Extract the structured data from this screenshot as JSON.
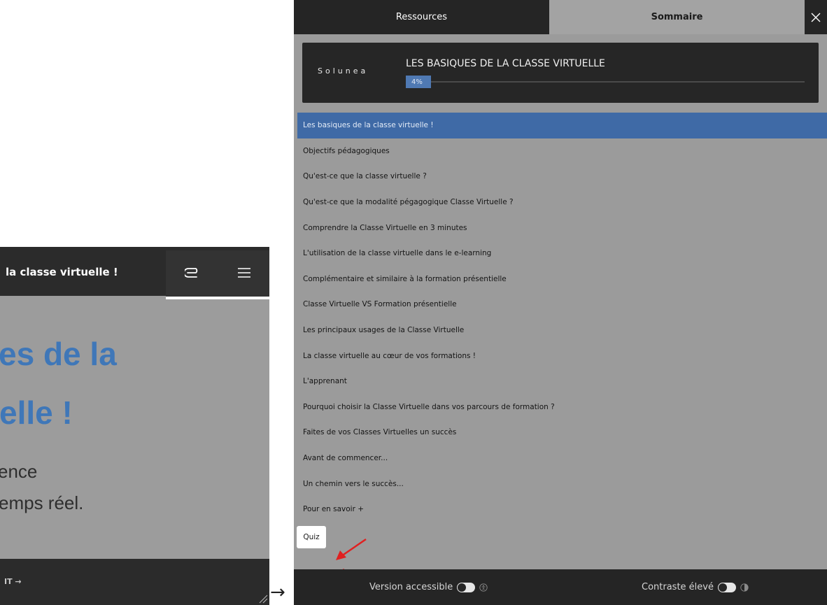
{
  "preview": {
    "header_title": "la classe virtuelle !",
    "hero_line1": "es de la",
    "hero_line2": "elle !",
    "hero_sub1": "ence",
    "hero_sub2": "emps réel.",
    "footer_cta": "IT →",
    "icons": {
      "clip": "paperclip-icon",
      "menu": "hamburger-menu-icon"
    }
  },
  "transition_arrow": "→",
  "panel": {
    "tabs": [
      {
        "label": "Ressources",
        "active": false
      },
      {
        "label": "Sommaire",
        "active": true
      }
    ],
    "close_icon": "close-icon",
    "course": {
      "logo": "Solunea",
      "title": "LES BASIQUES DE LA CLASSE VIRTUELLE",
      "progress_label": "4%",
      "progress": 0.04
    },
    "chapters": [
      {
        "label": "Les basiques de la classe virtuelle !",
        "active": true
      },
      {
        "label": "Objectifs pédagogiques"
      },
      {
        "label": "Qu'est-ce que la classe virtuelle ?"
      },
      {
        "label": "Qu'est-ce que la modalité pégagogique Classe Virtuelle ?"
      },
      {
        "label": "Comprendre la Classe Virtuelle en 3 minutes"
      },
      {
        "label": "L'utilisation de la classe virtuelle dans le e-learning"
      },
      {
        "label": "Complémentaire et similaire à la formation présentielle"
      },
      {
        "label": "Classe Virtuelle VS Formation présentielle"
      },
      {
        "label": "Les principaux usages de la Classe Virtuelle"
      },
      {
        "label": "La classe virtuelle au cœur de vos formations !"
      },
      {
        "label": "L'apprenant"
      },
      {
        "label": "Pourquoi choisir la Classe Virtuelle dans vos parcours de formation ?"
      },
      {
        "label": "Faites de vos Classes Virtuelles un succès"
      },
      {
        "label": "Avant de commencer..."
      },
      {
        "label": "Un chemin vers le succès..."
      },
      {
        "label": "Pour en savoir +"
      }
    ],
    "quiz_label": "Quiz",
    "footer": {
      "accessible_label": "Version accessible",
      "accessible_icon": "accessibility-icon",
      "contrast_label": "Contraste élevé",
      "contrast_icon": "contrast-icon"
    },
    "colors": {
      "accent": "#3f6aa6",
      "annotation": "#e02020"
    }
  }
}
